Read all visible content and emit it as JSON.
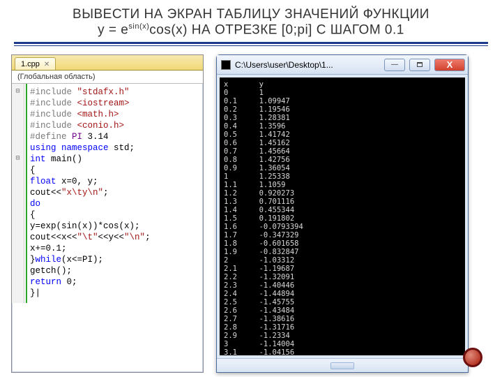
{
  "title_line1": "ВЫВЕСТИ НА ЭКРАН ТАБЛИЦУ ЗНАЧЕНИЙ ФУНКЦИИ",
  "title_line2_prefix": "y = e",
  "title_line2_sup": "sin(x)",
  "title_line2_suffix": "cos(x) НА ОТРЕЗКЕ [0;pi] С ШАГОМ 0.1",
  "editor": {
    "tab_label": "1.cpp",
    "scope_label": "(Глобальная область)",
    "lines": [
      {
        "raw": "#include \"stdafx.h\""
      },
      {
        "raw": "#include <iostream>"
      },
      {
        "raw": "#include <math.h>"
      },
      {
        "raw": "#include <conio.h>"
      },
      {
        "raw": "#define PI 3.14"
      },
      {
        "raw": "using namespace std;"
      },
      {
        "raw": "int main()"
      },
      {
        "raw": "{"
      },
      {
        "raw": "float x=0, y;"
      },
      {
        "raw": "cout<<\"x\\ty\\n\";"
      },
      {
        "raw": "do"
      },
      {
        "raw": "{"
      },
      {
        "raw": "y=exp(sin(x))*cos(x);"
      },
      {
        "raw": "cout<<x<<\"\\t\"<<y<<\"\\n\";"
      },
      {
        "raw": "x+=0.1;"
      },
      {
        "raw": "}while(x<=PI);"
      },
      {
        "raw": "getch();"
      },
      {
        "raw": "return 0;"
      },
      {
        "raw": "}|"
      }
    ]
  },
  "console": {
    "window_title": "C:\\Users\\user\\Desktop\\1...",
    "header": "x       y",
    "rows": [
      [
        "0",
        "1"
      ],
      [
        "0.1",
        "1.09947"
      ],
      [
        "0.2",
        "1.19546"
      ],
      [
        "0.3",
        "1.28381"
      ],
      [
        "0.4",
        "1.3596"
      ],
      [
        "0.5",
        "1.41742"
      ],
      [
        "0.6",
        "1.45162"
      ],
      [
        "0.7",
        "1.45664"
      ],
      [
        "0.8",
        "1.42756"
      ],
      [
        "0.9",
        "1.36054"
      ],
      [
        "1",
        "1.25338"
      ],
      [
        "1.1",
        "1.1059"
      ],
      [
        "1.2",
        "0.920273"
      ],
      [
        "1.3",
        "0.701116"
      ],
      [
        "1.4",
        "0.455344"
      ],
      [
        "1.5",
        "0.191802"
      ],
      [
        "1.6",
        "-0.0793394"
      ],
      [
        "1.7",
        "-0.347329"
      ],
      [
        "1.8",
        "-0.601658"
      ],
      [
        "1.9",
        "-0.832847"
      ],
      [
        "2",
        "-1.03312"
      ],
      [
        "2.1",
        "-1.19687"
      ],
      [
        "2.2",
        "-1.32091"
      ],
      [
        "2.3",
        "-1.40446"
      ],
      [
        "2.4",
        "-1.44894"
      ],
      [
        "2.5",
        "-1.45755"
      ],
      [
        "2.6",
        "-1.43484"
      ],
      [
        "2.7",
        "-1.38616"
      ],
      [
        "2.8",
        "-1.31716"
      ],
      [
        "2.9",
        "-1.2334"
      ],
      [
        "3",
        "-1.14004"
      ],
      [
        "3.1",
        "-1.04156"
      ]
    ]
  }
}
